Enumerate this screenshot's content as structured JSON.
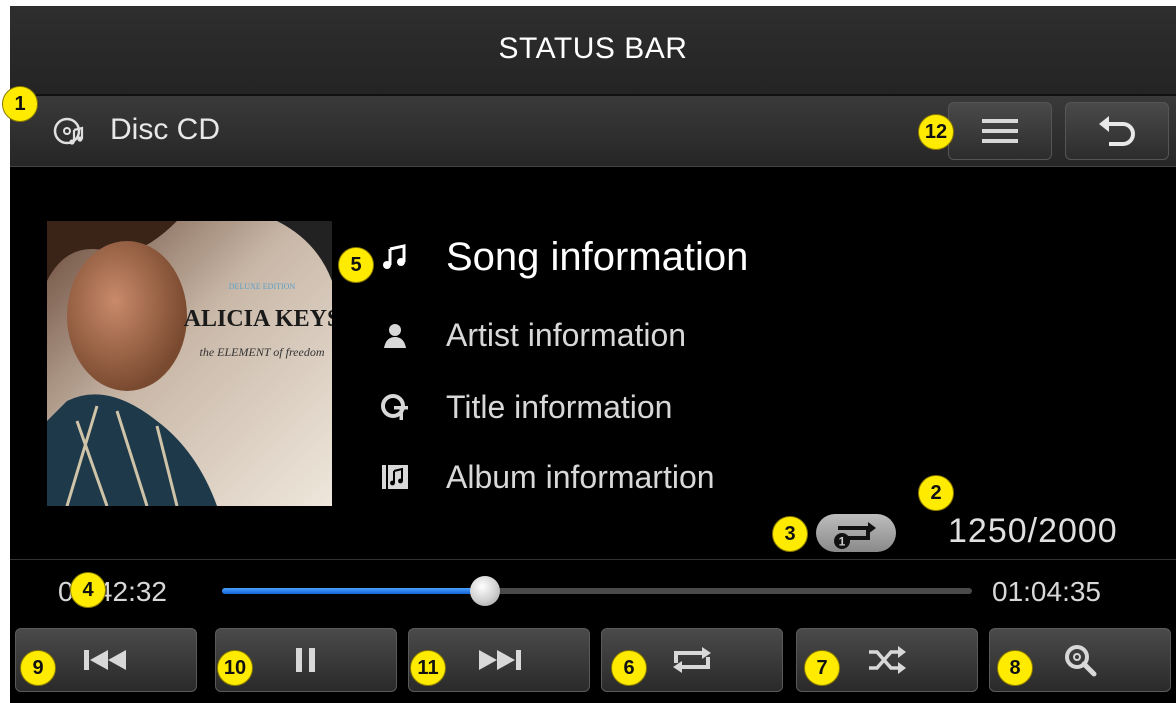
{
  "status_bar": {
    "label": "STATUS BAR"
  },
  "header": {
    "source_label": "Disc CD",
    "source_icon": "disc-music-icon",
    "menu_icon": "menu-icon",
    "back_icon": "back-arrow-icon"
  },
  "album_art": {
    "title_text": "ALICIA KEYS",
    "subtitle_text": "the ELEMENT of freedom",
    "edition_text": "DELUXE EDITION"
  },
  "track_info": {
    "song": {
      "label": "Song information",
      "icon": "music-note-icon"
    },
    "artist": {
      "label": "Artist information",
      "icon": "person-icon"
    },
    "title": {
      "label": "Title information",
      "icon": "title-disc-icon"
    },
    "album": {
      "label": "Album informartion",
      "icon": "album-icon"
    }
  },
  "counter": "1250/2000",
  "progress": {
    "elapsed": "00:42:32",
    "total": "01:04:35",
    "fraction": 0.35
  },
  "controls": [
    {
      "name": "previous",
      "icon": "previous-track-icon"
    },
    {
      "name": "pause",
      "icon": "pause-icon"
    },
    {
      "name": "next",
      "icon": "next-track-icon"
    },
    {
      "name": "repeat",
      "icon": "repeat-icon"
    },
    {
      "name": "shuffle",
      "icon": "shuffle-icon"
    },
    {
      "name": "search",
      "icon": "search-icon"
    }
  ],
  "callouts": [
    "1",
    "2",
    "3",
    "4",
    "5",
    "6",
    "7",
    "8",
    "9",
    "10",
    "11",
    "12"
  ],
  "colors": {
    "accent": "#1e7ae8",
    "callout": "#ffeb00",
    "background": "#000000"
  }
}
